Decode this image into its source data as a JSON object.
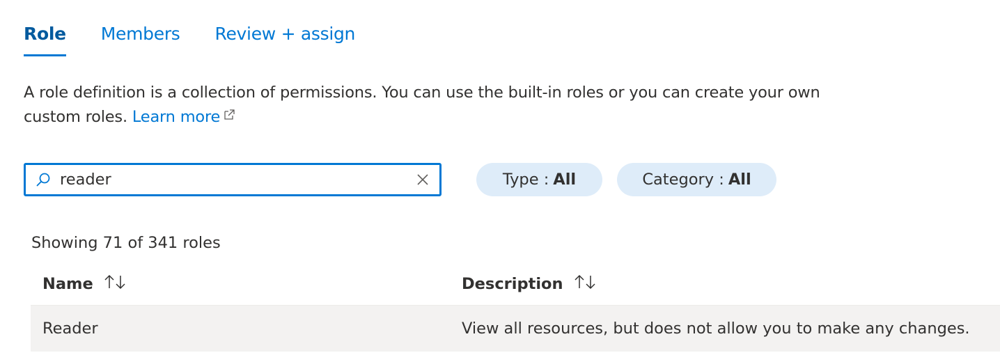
{
  "tabs": [
    {
      "label": "Role",
      "active": true
    },
    {
      "label": "Members",
      "active": false
    },
    {
      "label": "Review + assign",
      "active": false
    }
  ],
  "intro": {
    "text": "A role definition is a collection of permissions. You can use the built-in roles or you can create your own custom roles.",
    "link_label": "Learn more",
    "link_icon": "external-link-icon"
  },
  "search": {
    "value": "reader",
    "icon": "search-icon",
    "clear_icon": "close-icon"
  },
  "filters": [
    {
      "key": "Type :",
      "value": "All"
    },
    {
      "key": "Category :",
      "value": "All"
    }
  ],
  "results": {
    "summary": "Showing 71 of 341 roles"
  },
  "table": {
    "columns": [
      {
        "label": "Name",
        "sort_icon": "sort-arrows-icon"
      },
      {
        "label": "Description",
        "sort_icon": "sort-arrows-icon"
      }
    ],
    "rows": [
      {
        "name": "Reader",
        "description": "View all resources, but does not allow you to make any changes."
      }
    ]
  },
  "colors": {
    "accent": "#0078d4",
    "pill_bg": "#deecf9",
    "row_bg": "#f3f2f1",
    "text": "#323130"
  }
}
